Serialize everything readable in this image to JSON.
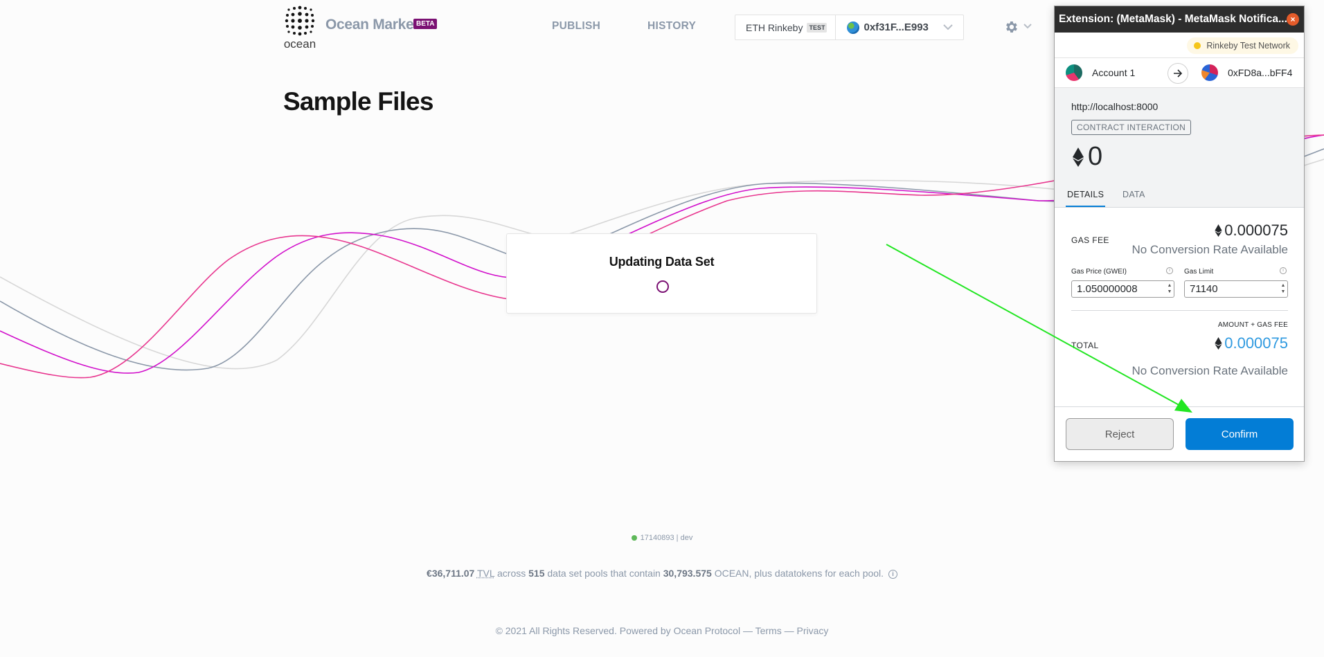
{
  "header": {
    "logo_word": "ocean",
    "brand": "Ocean Market",
    "beta": "BETA",
    "nav": {
      "publish": "PUBLISH",
      "history": "HISTORY"
    },
    "wallet": {
      "network": "ETH Rinkeby",
      "network_badge": "TEST",
      "account": "0xf31F...E993"
    }
  },
  "page": {
    "title": "Sample Files"
  },
  "update_card": {
    "title": "Updating Data Set"
  },
  "footer": {
    "block": "17140893",
    "sep": "|",
    "env": "dev",
    "stats": {
      "tvl_value": "€36,711.07",
      "tvl_abbr": "TVL",
      "t_across": "across",
      "pools": "515",
      "t_pools": "data set pools that contain",
      "ocean": "30,793.575",
      "t_suffix": "OCEAN, plus datatokens for each pool.",
      "info": "i"
    },
    "copyright": "© 2021 All Rights Reserved. Powered by",
    "powered": "Ocean Protocol",
    "dash": "—",
    "terms": "Terms",
    "privacy": "Privacy"
  },
  "metamask": {
    "window_title": "Extension: (MetaMask) - MetaMask Notifica...",
    "close": "×",
    "network": "Rinkeby Test Network",
    "from_account": "Account 1",
    "to_account": "0xFD8a...bFF4",
    "origin": "http://localhost:8000",
    "action": "CONTRACT INTERACTION",
    "amount": "0",
    "tabs": {
      "details": "DETAILS",
      "data": "DATA"
    },
    "gas_fee_label": "GAS FEE",
    "gas_fee_value": "0.000075",
    "no_conversion": "No Conversion Rate Available",
    "gas_price_label": "Gas Price (GWEI)",
    "gas_price_value": "1.050000008",
    "gas_limit_label": "Gas Limit",
    "gas_limit_value": "71140",
    "amount_gas_label": "AMOUNT + GAS FEE",
    "total_label": "TOTAL",
    "total_value": "0.000075",
    "reject": "Reject",
    "confirm": "Confirm"
  },
  "colors": {
    "accent_purple": "#7b1173",
    "metamask_blue": "#037dd6",
    "total_blue": "#2f9ae0",
    "wave_pink": "#e8368f",
    "wave_magenta": "#d10fcb",
    "wave_slate": "#8b98a9",
    "wave_light": "#d7d7d7",
    "annotation_green": "#22e622"
  },
  "icons": {
    "logo": "ocean-dots-logo-icon",
    "wallet_network": "globe-icon",
    "settings": "gear-icon",
    "dropdown": "chevron-down-icon",
    "transfer": "arrow-right-icon",
    "eth": "ethereum-icon",
    "info": "info-icon",
    "spinner": "spinner-icon"
  }
}
